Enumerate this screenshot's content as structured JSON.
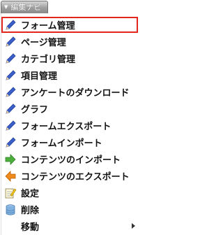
{
  "nav": {
    "title": "編集ナビ",
    "items": [
      {
        "label": "フォーム管理",
        "icon": "pencil-icon",
        "selected": true
      },
      {
        "label": "ページ管理",
        "icon": "pencil-icon"
      },
      {
        "label": "カテゴリ管理",
        "icon": "pencil-icon"
      },
      {
        "label": "項目管理",
        "icon": "pencil-icon"
      },
      {
        "label": "アンケートのダウンロード",
        "icon": "pencil-icon"
      },
      {
        "label": "グラフ",
        "icon": "pencil-icon"
      },
      {
        "label": "フォームエクスポート",
        "icon": "pencil-icon"
      },
      {
        "label": "フォームインポート",
        "icon": "pencil-icon"
      },
      {
        "label": "コンテンツのインポート",
        "icon": "green-arrow-right-icon"
      },
      {
        "label": "コンテンツのエクスポート",
        "icon": "orange-arrow-left-icon"
      },
      {
        "label": "設定",
        "icon": "notepad-pencil-icon"
      },
      {
        "label": "削除",
        "icon": "database-delete-icon"
      },
      {
        "label": "移動",
        "icon": "move-icon",
        "has_submenu": true
      }
    ]
  },
  "colors": {
    "selection_border": "#e3271f",
    "pencil_blue": "#3b5fc8",
    "import_green": "#4caf3c",
    "export_orange": "#f08a1c"
  }
}
